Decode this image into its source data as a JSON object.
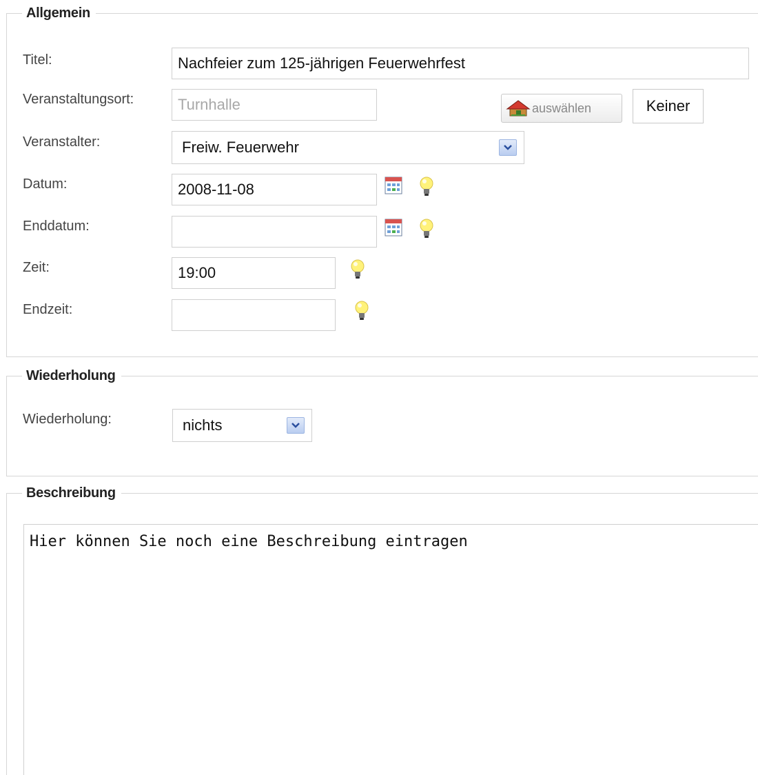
{
  "allgemein": {
    "legend": "Allgemein",
    "titel": {
      "label": "Titel:",
      "value": "Nachfeier zum 125-jährigen Feuerwehrfest"
    },
    "veranstaltungsort": {
      "label": "Veranstaltungsort:",
      "value": "Turnhalle",
      "select_button": "auswählen",
      "none_button": "Keiner"
    },
    "veranstalter": {
      "label": "Veranstalter:",
      "selected": "Freiw. Feuerwehr"
    },
    "datum": {
      "label": "Datum:",
      "value": "2008-11-08"
    },
    "enddatum": {
      "label": "Enddatum:",
      "value": ""
    },
    "zeit": {
      "label": "Zeit:",
      "value": "19:00"
    },
    "endzeit": {
      "label": "Endzeit:",
      "value": ""
    }
  },
  "wiederholung": {
    "legend": "Wiederholung",
    "label": "Wiederholung:",
    "selected": "nichts"
  },
  "beschreibung": {
    "legend": "Beschreibung",
    "value": "Hier können Sie noch eine Beschreibung eintragen"
  },
  "icons": {
    "calendar": "calendar-icon",
    "hint": "lightbulb-icon",
    "home": "home-icon",
    "dropdown": "chevron-down-icon"
  }
}
